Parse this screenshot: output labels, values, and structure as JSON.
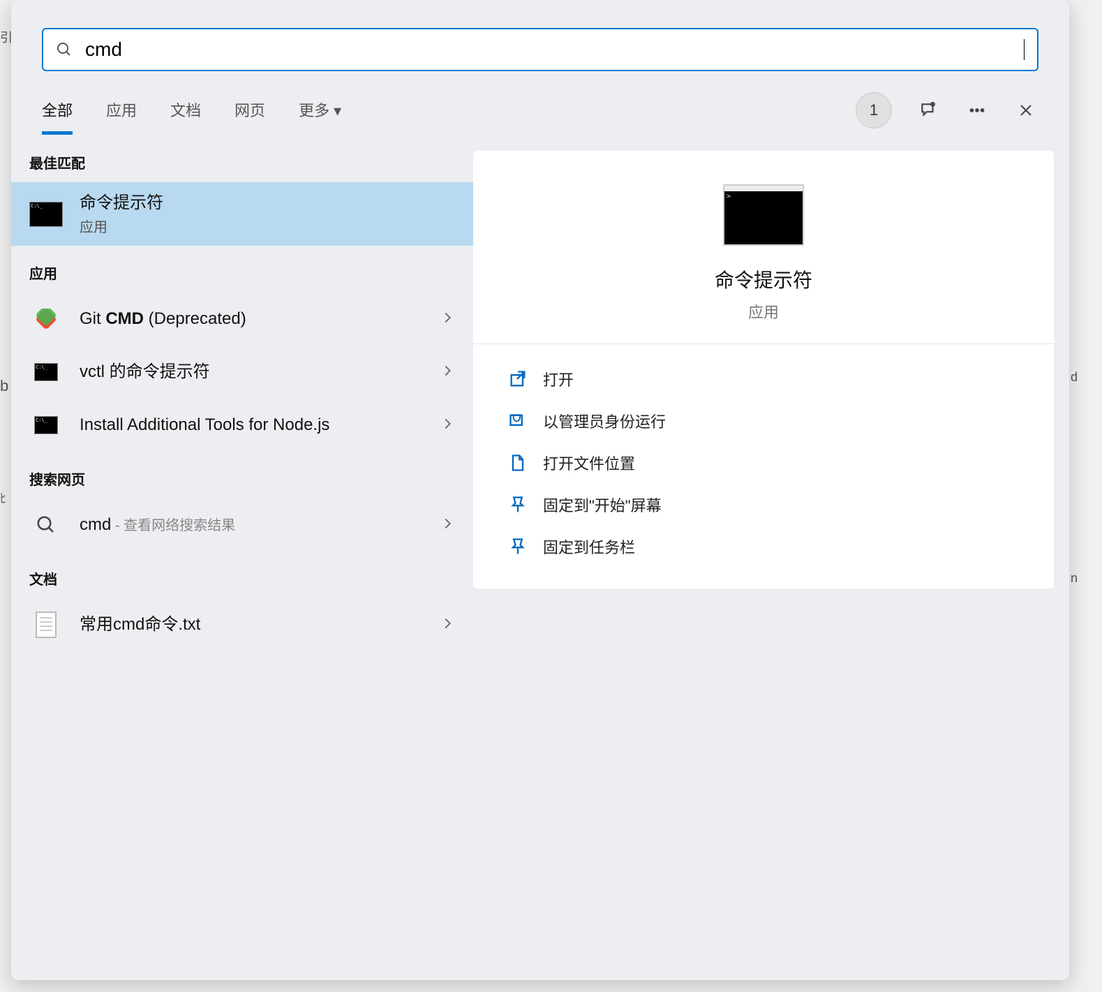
{
  "search": {
    "query": "cmd",
    "placeholder": ""
  },
  "tabs": {
    "all": "全部",
    "apps": "应用",
    "docs": "文档",
    "web": "网页",
    "more": "更多"
  },
  "toolbar": {
    "badge": "1"
  },
  "sections": {
    "best_match": "最佳匹配",
    "apps": "应用",
    "search_web": "搜索网页",
    "documents": "文档"
  },
  "results": {
    "best_match": {
      "title": "命令提示符",
      "subtitle": "应用"
    },
    "apps": [
      {
        "prefix": "Git ",
        "bold": "CMD",
        "suffix": " (Deprecated)"
      },
      {
        "title": "vctl 的命令提示符"
      },
      {
        "title": "Install Additional Tools for Node.js"
      }
    ],
    "web": {
      "term": "cmd",
      "suffix_sep": " - ",
      "suffix": "查看网络搜索结果"
    },
    "documents": [
      {
        "title": "常用cmd命令.txt"
      }
    ]
  },
  "preview": {
    "title": "命令提示符",
    "type": "应用",
    "actions": {
      "open": "打开",
      "run_admin": "以管理员身份运行",
      "open_location": "打开文件位置",
      "pin_start": "固定到\"开始\"屏幕",
      "pin_taskbar": "固定到任务栏"
    }
  }
}
